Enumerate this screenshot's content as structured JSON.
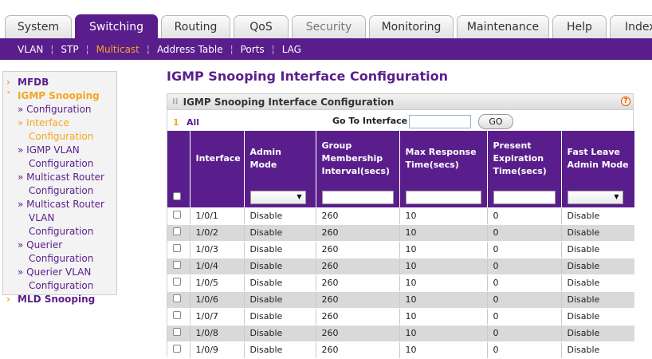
{
  "top_tabs": [
    "System",
    "Switching",
    "Routing",
    "QoS",
    "Security",
    "Monitoring",
    "Maintenance",
    "Help",
    "Index"
  ],
  "sub_nav": [
    "VLAN",
    "STP",
    "Multicast",
    "Address Table",
    "Ports",
    "LAG"
  ],
  "left_nav": {
    "mfdb": "MFDB",
    "igmp_snooping": "IGMP Snooping",
    "configuration": "Configuration",
    "interface": "Interface",
    "interface_cont": "Configuration",
    "igmp_vlan": "IGMP VLAN",
    "igmp_vlan_cont": "Configuration",
    "multicast_router": "Multicast Router",
    "multicast_router_cont": "Configuration",
    "multicast_router_vlan": "Multicast Router",
    "multicast_router_vlan_cont": "VLAN Configuration",
    "querier": "Querier",
    "querier_cont": "Configuration",
    "querier_vlan": "Querier VLAN",
    "querier_vlan_cont": "Configuration",
    "mld_snooping": "MLD Snooping"
  },
  "page_title": "IGMP Snooping Interface Configuration",
  "panel": {
    "title": "IGMP Snooping Interface Configuration",
    "help_icon": "?",
    "filter_num": "1",
    "filter_all": "All",
    "goto_label": "Go To Interface",
    "goto_value": "",
    "go_button": "GO"
  },
  "table": {
    "headers": [
      "Interface",
      "Admin Mode",
      "Group Membership Interval(secs)",
      "Max Response Time(secs)",
      "Present Expiration Time(secs)",
      "Fast Leave Admin Mode"
    ],
    "rows": [
      [
        "1/0/1",
        "Disable",
        "260",
        "10",
        "0",
        "Disable"
      ],
      [
        "1/0/2",
        "Disable",
        "260",
        "10",
        "0",
        "Disable"
      ],
      [
        "1/0/3",
        "Disable",
        "260",
        "10",
        "0",
        "Disable"
      ],
      [
        "1/0/4",
        "Disable",
        "260",
        "10",
        "0",
        "Disable"
      ],
      [
        "1/0/5",
        "Disable",
        "260",
        "10",
        "0",
        "Disable"
      ],
      [
        "1/0/6",
        "Disable",
        "260",
        "10",
        "0",
        "Disable"
      ],
      [
        "1/0/7",
        "Disable",
        "260",
        "10",
        "0",
        "Disable"
      ],
      [
        "1/0/8",
        "Disable",
        "260",
        "10",
        "0",
        "Disable"
      ],
      [
        "1/0/9",
        "Disable",
        "260",
        "10",
        "0",
        "Disable"
      ]
    ]
  },
  "colors": {
    "brand": "#5a1e8c",
    "accent": "#f5a623",
    "row_alt": "#d9d9d9"
  }
}
